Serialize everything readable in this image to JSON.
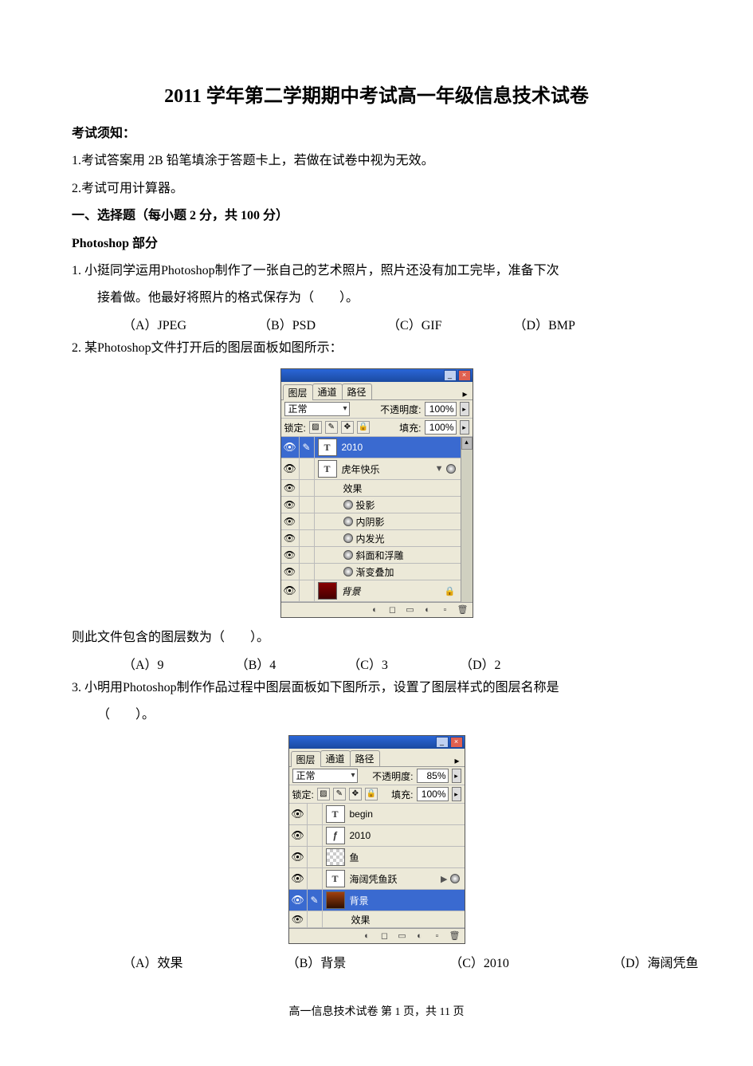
{
  "title": "2011 学年第二学期期中考试高一年级信息技术试卷",
  "notice_heading": "考试须知：",
  "notice_1": "1.考试答案用 2B 铅笔填涂于答题卡上，若做在试卷中视为无效。",
  "notice_2": "2.考试可用计算器。",
  "section_heading": "一、选择题（每小题 2 分，共 100 分）",
  "subsection_heading": "Photoshop 部分",
  "q1": {
    "num": "1.",
    "text1": "小挺同学运用Photoshop制作了一张自己的艺术照片，照片还没有加工完毕，准备下次",
    "text2": "接着做。他最好将照片的格式保存为（　　）。",
    "a": "（A）JPEG",
    "b": "（B）PSD",
    "c": "（C）GIF",
    "d": "（D）BMP"
  },
  "q2": {
    "num": "2.",
    "text": "某Photoshop文件打开后的图层面板如图所示：",
    "after": "则此文件包含的图层数为（　　）。",
    "a": "（A）9",
    "b": "（B）4",
    "c": "（C）3",
    "d": "（D）2"
  },
  "q3": {
    "num": "3.",
    "text1": "小明用Photoshop制作作品过程中图层面板如下图所示，设置了图层样式的图层名称是",
    "text2": "（　　）。",
    "a": "（A）效果",
    "b": "（B）背景",
    "c": "（C）2010",
    "d": "（D）海阔凭鱼"
  },
  "panel1": {
    "tabs": [
      "图层",
      "通道",
      "路径"
    ],
    "blend": "正常",
    "opacity_label": "不透明度:",
    "opacity": "100%",
    "lock_label": "锁定:",
    "fill_label": "填充:",
    "fill": "100%",
    "layers": {
      "l1": "2010",
      "l2": "虎年快乐",
      "fx_label": "效果",
      "fx": [
        "投影",
        "内阴影",
        "内发光",
        "斜面和浮雕",
        "渐变叠加"
      ],
      "l3": "背景"
    }
  },
  "panel2": {
    "tabs": [
      "图层",
      "通道",
      "路径"
    ],
    "blend": "正常",
    "opacity_label": "不透明度:",
    "opacity": "85%",
    "lock_label": "锁定:",
    "fill_label": "填充:",
    "fill": "100%",
    "layers": {
      "l1": "begin",
      "l2": "2010",
      "l3": "鱼",
      "l4": "海阔凭鱼跃",
      "l5": "背景",
      "fx_label": "效果"
    }
  },
  "footer": "高一信息技术试卷 第 1 页，共 11 页"
}
